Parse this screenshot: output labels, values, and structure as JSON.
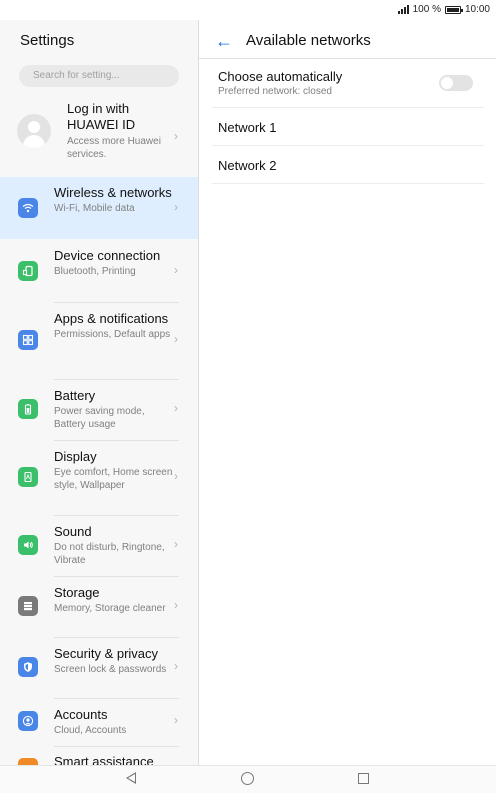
{
  "status_bar": {
    "battery_text": "100 %",
    "time": "10:00"
  },
  "left": {
    "title": "Settings",
    "search_placeholder": "Search for setting...",
    "login": {
      "title": "Log in with HUAWEI ID",
      "subtitle": "Access more Huawei services."
    },
    "items": [
      {
        "title": "Wireless & networks",
        "subtitle": "Wi-Fi, Mobile data",
        "icon": "wifi-icon",
        "color": "#4a86e8"
      },
      {
        "title": "Device connection",
        "subtitle": "Bluetooth, Printing",
        "icon": "device-connection-icon",
        "color": "#3cbf6a"
      },
      {
        "title": "Apps & notifications",
        "subtitle": "Permissions, Default apps",
        "icon": "apps-icon",
        "color": "#4a86e8"
      },
      {
        "title": "Battery",
        "subtitle": "Power saving mode, Battery usage",
        "icon": "battery-icon",
        "color": "#3cbf6a"
      },
      {
        "title": "Display",
        "subtitle": "Eye comfort, Home screen style, Wallpaper",
        "icon": "display-icon",
        "color": "#3cbf6a"
      },
      {
        "title": "Sound",
        "subtitle": "Do not disturb, Ringtone, Vibrate",
        "icon": "sound-icon",
        "color": "#3cbf6a"
      },
      {
        "title": "Storage",
        "subtitle": "Memory, Storage cleaner",
        "icon": "storage-icon",
        "color": "#7a7a7a"
      },
      {
        "title": "Security & privacy",
        "subtitle": "Screen lock & passwords",
        "icon": "shield-icon",
        "color": "#4a86e8"
      },
      {
        "title": "Accounts",
        "subtitle": "Cloud, Accounts",
        "icon": "account-icon",
        "color": "#4a86e8"
      },
      {
        "title": "Smart assistance",
        "subtitle": "",
        "icon": "smart-assistance-icon",
        "color": "#f08a24"
      }
    ]
  },
  "right": {
    "title": "Available networks",
    "auto": {
      "title": "Choose automatically",
      "subtitle": "Preferred network: closed",
      "enabled": false
    },
    "networks": [
      "Network 1",
      "Network 2"
    ]
  }
}
